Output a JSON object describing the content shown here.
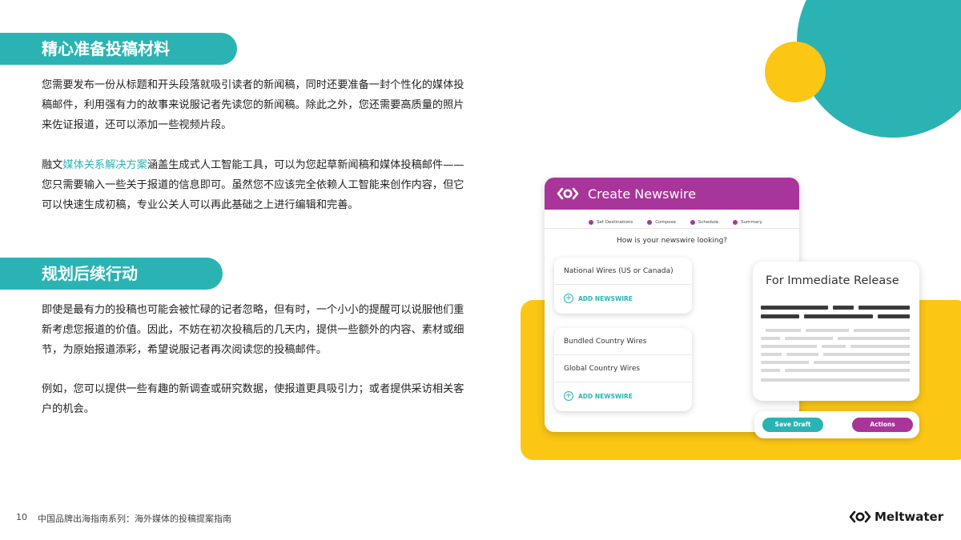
{
  "sections": [
    {
      "title": "精心准备投稿材料"
    },
    {
      "title": "规划后续行动"
    }
  ],
  "paragraphs": {
    "p1": "您需要发布一份从标题和开头段落就吸引读者的新闻稿，同时还要准备一封个性化的媒体投稿邮件，利用强有力的故事来说服记者先读您的新闻稿。除此之外，您还需要高质量的照片来佐证报道，还可以添加一些视频片段。",
    "p2_before": "融文",
    "p2_link": "媒体关系解决方案",
    "p2_after": "涵盖生成式人工智能工具，可以为您起草新闻稿和媒体投稿邮件——您只需要输入一些关于报道的信息即可。虽然您不应该完全依赖人工智能来创作内容，但它可以快速生成初稿，专业公关人可以再此基础之上进行编辑和完善。",
    "p3": "即使是最有力的投稿也可能会被忙碌的记者忽略，但有时，一个小小的提醒可以说服他们重新考虑您报道的价值。因此，不妨在初次投稿后的几天内，提供一些额外的内容、素材或细节，为原始报道添彩，希望说服记者再次阅读您的投稿邮件。",
    "p4": "例如，您可以提供一些有趣的新调查或研究数据，使报道更具吸引力；或者提供采访相关客户的机会。"
  },
  "footer": {
    "page_number": "10",
    "doc_title": "中国品牌出海指南系列：海外媒体的投稿提案指南",
    "brand": "Meltwater"
  },
  "newswire_card": {
    "title": "Create Newswire",
    "steps": [
      "Set Destinations",
      "Compose",
      "Schedule",
      "Summary"
    ],
    "question": "How is your newswire looking?",
    "box1": {
      "items": [
        "National Wires (US or Canada)"
      ],
      "add_label": "ADD NEWSWIRE"
    },
    "box2": {
      "items": [
        "Bundled Country Wires",
        "Global Country Wires"
      ],
      "add_label": "ADD NEWSWIRE"
    }
  },
  "release_card": {
    "title": "For Immediate Release"
  },
  "action_bar": {
    "save_label": "Save Draft",
    "actions_label": "Actions"
  },
  "colors": {
    "teal": "#2bb3b3",
    "yellow": "#fbc614",
    "purple": "#a8359a"
  }
}
